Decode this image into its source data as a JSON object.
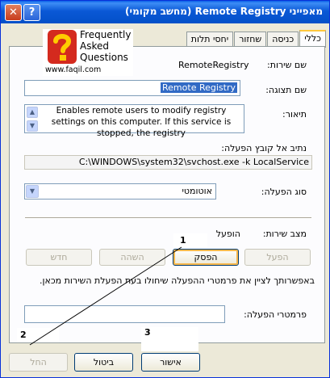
{
  "window": {
    "title": "מאפייני Remote Registry (מחשב מקומי)",
    "close_glyph": "✕",
    "help_glyph": "?"
  },
  "tabs": [
    {
      "label": "כללי",
      "active": true
    },
    {
      "label": "כניסה",
      "active": false
    },
    {
      "label": "שחזור",
      "active": false
    },
    {
      "label": "יחסי תלות",
      "active": false
    }
  ],
  "general": {
    "service_name_label": "שם שירות:",
    "service_name": "RemoteRegistry",
    "display_name_label": "שם תצוגה:",
    "display_name": "Remote Registry",
    "description_label": "תיאור:",
    "description": "Enables remote users to modify registry settings on this computer. If this service is stopped, the registry",
    "path_label": "נתיב אל קובץ הפעלה:",
    "path": "C:\\WINDOWS\\system32\\svchost.exe -k LocalService",
    "startup_type_label": "סוג הפעלה:",
    "startup_type": "אוטומטי",
    "status_label": "מצב שירות:",
    "status": "הופעל",
    "start_button": "הפעל",
    "stop_button": "הפסק",
    "pause_button": "השהה",
    "resume_button": "חדש",
    "info_text": "באפשרותך לציין את פרמטרי ההפעלה שיחולו בעת הפעלת השירות מכאן.",
    "start_params_label": "פרמטרי הפעלה:",
    "start_params_value": ""
  },
  "footer": {
    "ok_button": "אישור",
    "cancel_button": "ביטול",
    "apply_button": "החל"
  },
  "annotations": {
    "mark_1": "1",
    "mark_2": "2",
    "mark_3": "3"
  },
  "logo": {
    "line1": "Frequently",
    "line2": "Asked",
    "line3": "Questions",
    "url": "www.faqil.com"
  },
  "colors": {
    "titlebar": "#0a58d6",
    "dialog_bg": "#ece9d8",
    "selection": "#316ac5",
    "focus": "#f8b84c",
    "logo_red": "#d42a1e",
    "logo_yellow": "#ffcc00"
  }
}
